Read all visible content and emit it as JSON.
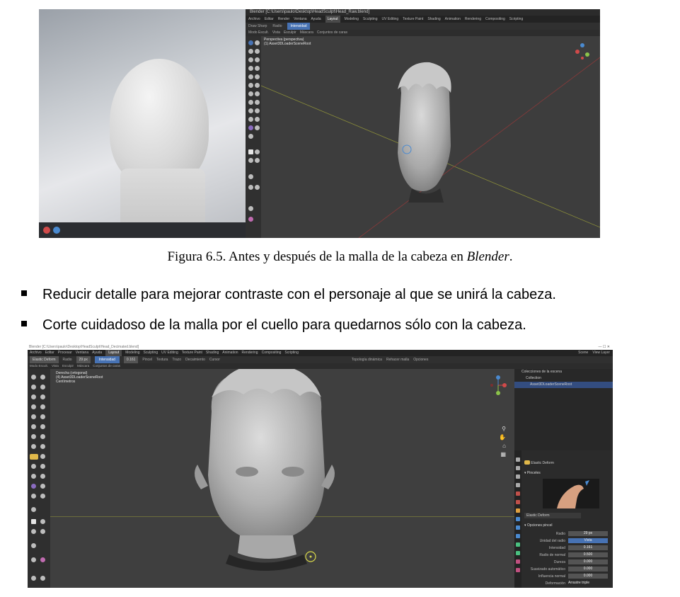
{
  "figure_top": {
    "blender": {
      "title": "Blender [C:\\Users\\paulo\\Desktop\\HeadSculpt\\Head_Raw.blend]",
      "menu": [
        "Archivo",
        "Editar",
        "Render",
        "Ventana",
        "Ayuda",
        "Layout",
        "Modeling",
        "Sculpting",
        "UV Editing",
        "Texture Paint",
        "Shading",
        "Animation",
        "Rendering",
        "Compositing",
        "Scripting"
      ],
      "active_workspace": "Layout",
      "header": [
        "Draw Sharp",
        "Radio",
        "Intensidad"
      ],
      "subheader": [
        "Modo Escult.",
        "Vista",
        "Esculpir",
        "Máscara",
        "Conjuntos de caras"
      ],
      "overlay_lines": [
        "Perspectiva (perspectiva)",
        "(1) Asset3DLoaderSceneRoot"
      ]
    }
  },
  "caption": {
    "prefix": "Figura 6.5. Antes y después de la malla de la cabeza en ",
    "italic": "Blender",
    "suffix": "."
  },
  "bullets": [
    "Reducir detalle para mejorar contraste con el personaje al que se unirá la cabeza.",
    "Corte cuidadoso de la malla por el cuello para quedarnos sólo con la cabeza."
  ],
  "figure_bottom": {
    "blender": {
      "title": "Blender [C:\\Users\\paulo\\Desktop\\HeadSculpt\\Head_Decimated.blend]",
      "menu": [
        "Archivo",
        "Editar",
        "Procesar",
        "Ventana",
        "Ayuda",
        "Layout",
        "Modeling",
        "Sculpting",
        "UV Editing",
        "Texture Paint",
        "Shading",
        "Animation",
        "Rendering",
        "Compositing",
        "Scripting"
      ],
      "active_workspace": "Layout",
      "menu_right": [
        "Scene",
        "View Layer"
      ],
      "header": {
        "brush": "Elastic Deform",
        "radius_label": "Radio",
        "radius_value": "29 px",
        "strength_label": "Intensidad",
        "strength_value": "0.161",
        "items": [
          "Pincel",
          "Textura",
          "Trazo",
          "Decaimiento",
          "Cursor"
        ],
        "right_items": [
          "Topología dinámica",
          "Rehacer malla",
          "Opciones"
        ]
      },
      "subheader": [
        "Modo Escult.",
        "Vista",
        "Esculpir",
        "Máscara",
        "Conjuntos de caras"
      ],
      "overlay_lines": [
        "Derecha (ortogonal)",
        "(4) Asset3DLoaderSceneRoot",
        "Centímetros"
      ],
      "outliner": {
        "rows": [
          "Colecciones de la escena",
          "Collection",
          "Asset3DLoaderSceneRoot"
        ]
      },
      "properties": {
        "brush_name": "Elastic Deform",
        "section_brushes": "Pinceles",
        "brush_field": "Elastic Deform",
        "section_options": "Opciones pincel",
        "rows": [
          {
            "label": "Radio",
            "value": "29 px"
          },
          {
            "label": "Unidad del radio",
            "value": "Vista"
          },
          {
            "label": "Intensidad",
            "value": "0.161"
          },
          {
            "label": "Radio de normal",
            "value": "0.500"
          },
          {
            "label": "Dureza",
            "value": "0.000"
          },
          {
            "label": "Suavizado automático",
            "value": "0.000"
          },
          {
            "label": "Influencia normal",
            "value": "0.000"
          },
          {
            "label": "Deformación",
            "value": "Arrastre triple"
          }
        ]
      }
    }
  }
}
